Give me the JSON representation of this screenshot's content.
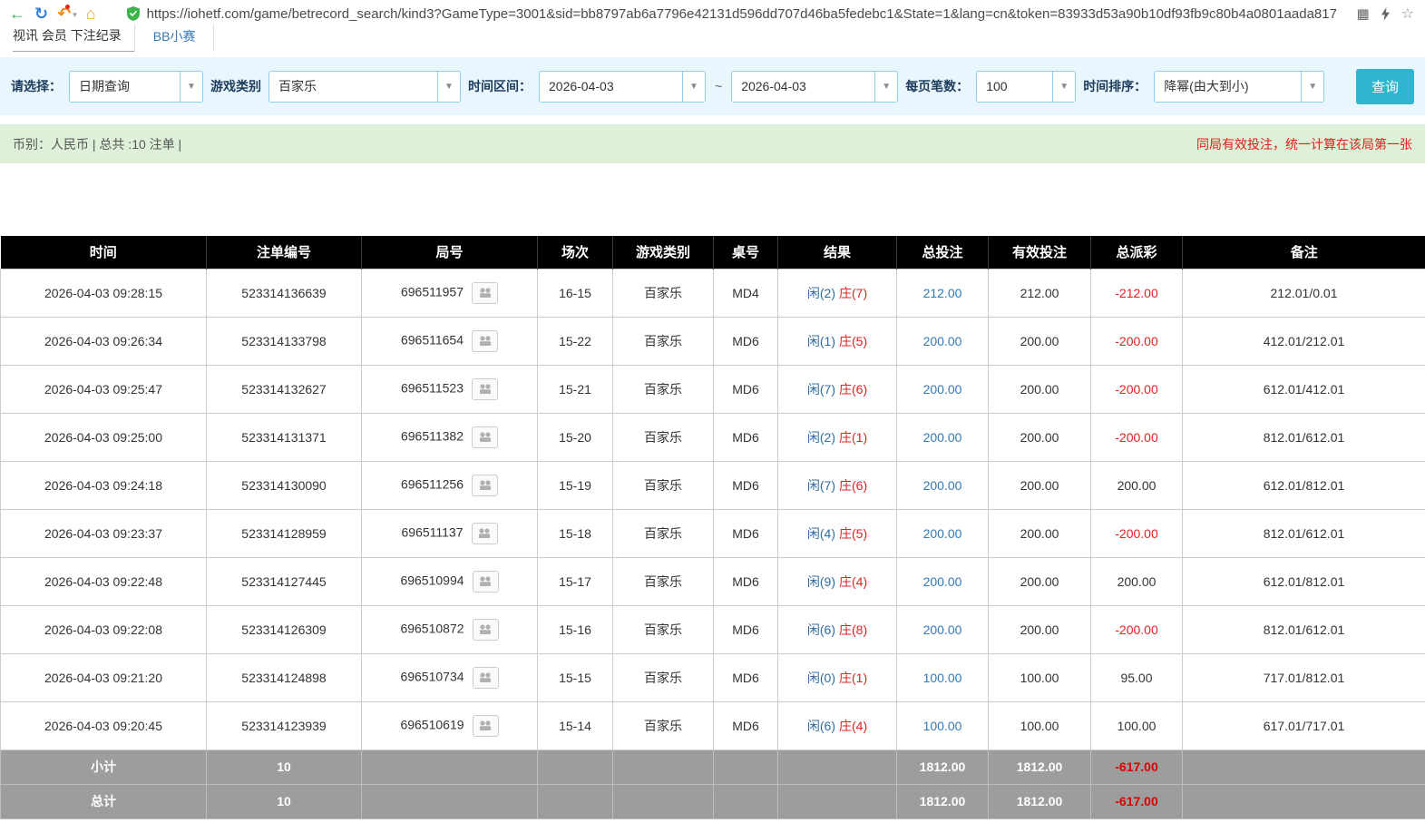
{
  "browser": {
    "url": "https://iohetf.com/game/betrecord_search/kind3?GameType=3001&sid=bb8797ab6a7796e42131d596dd707d46ba5fedebc1&State=1&lang=cn&token=83933d53a90b10df93fb9c80b4a0801aada817"
  },
  "icons": {
    "back": "←",
    "refresh": "↻",
    "undo": "↶",
    "caret_small": "▾",
    "home": "⌂",
    "grid": "▦",
    "star": "☆",
    "dropdown_caret": "▼"
  },
  "nav": {
    "breadcrumb": "视讯 会员 下注纪录",
    "tab": "BB小赛"
  },
  "filters": {
    "select_label": "请选择：",
    "select_value": "日期查询",
    "game_type_label": "游戏类别",
    "game_type_value": "百家乐",
    "date_range_label": "时间区间：",
    "date_from": "2026-04-03",
    "date_separator": "~",
    "date_to": "2026-04-03",
    "page_size_label": "每页笔数：",
    "page_size_value": "100",
    "sort_label": "时间排序：",
    "sort_value": "降幂(由大到小)",
    "search_button": "查询"
  },
  "summary": {
    "left": "币别：人民币 | 总共 :10 注单 |",
    "right": "同局有效投注，统一计算在该局第一张"
  },
  "table": {
    "headers": [
      "时间",
      "注单编号",
      "局号",
      "场次",
      "游戏类别",
      "桌号",
      "结果",
      "总投注",
      "有效投注",
      "总派彩",
      "备注"
    ],
    "rows": [
      {
        "time": "2026-04-03 09:28:15",
        "bet_id": "523314136639",
        "round_id": "696511957",
        "session": "16-15",
        "game": "百家乐",
        "table_no": "MD4",
        "result_player": "闲(2)",
        "result_banker": "庄(7)",
        "total_bet": "212.00",
        "valid_bet": "212.00",
        "payout": "-212.00",
        "remark": "212.01/0.01"
      },
      {
        "time": "2026-04-03 09:26:34",
        "bet_id": "523314133798",
        "round_id": "696511654",
        "session": "15-22",
        "game": "百家乐",
        "table_no": "MD6",
        "result_player": "闲(1)",
        "result_banker": "庄(5)",
        "total_bet": "200.00",
        "valid_bet": "200.00",
        "payout": "-200.00",
        "remark": "412.01/212.01"
      },
      {
        "time": "2026-04-03 09:25:47",
        "bet_id": "523314132627",
        "round_id": "696511523",
        "session": "15-21",
        "game": "百家乐",
        "table_no": "MD6",
        "result_player": "闲(7)",
        "result_banker": "庄(6)",
        "total_bet": "200.00",
        "valid_bet": "200.00",
        "payout": "-200.00",
        "remark": "612.01/412.01"
      },
      {
        "time": "2026-04-03 09:25:00",
        "bet_id": "523314131371",
        "round_id": "696511382",
        "session": "15-20",
        "game": "百家乐",
        "table_no": "MD6",
        "result_player": "闲(2)",
        "result_banker": "庄(1)",
        "total_bet": "200.00",
        "valid_bet": "200.00",
        "payout": "-200.00",
        "remark": "812.01/612.01"
      },
      {
        "time": "2026-04-03 09:24:18",
        "bet_id": "523314130090",
        "round_id": "696511256",
        "session": "15-19",
        "game": "百家乐",
        "table_no": "MD6",
        "result_player": "闲(7)",
        "result_banker": "庄(6)",
        "total_bet": "200.00",
        "valid_bet": "200.00",
        "payout": "200.00",
        "remark": "612.01/812.01"
      },
      {
        "time": "2026-04-03 09:23:37",
        "bet_id": "523314128959",
        "round_id": "696511137",
        "session": "15-18",
        "game": "百家乐",
        "table_no": "MD6",
        "result_player": "闲(4)",
        "result_banker": "庄(5)",
        "total_bet": "200.00",
        "valid_bet": "200.00",
        "payout": "-200.00",
        "remark": "812.01/612.01"
      },
      {
        "time": "2026-04-03 09:22:48",
        "bet_id": "523314127445",
        "round_id": "696510994",
        "session": "15-17",
        "game": "百家乐",
        "table_no": "MD6",
        "result_player": "闲(9)",
        "result_banker": "庄(4)",
        "total_bet": "200.00",
        "valid_bet": "200.00",
        "payout": "200.00",
        "remark": "612.01/812.01"
      },
      {
        "time": "2026-04-03 09:22:08",
        "bet_id": "523314126309",
        "round_id": "696510872",
        "session": "15-16",
        "game": "百家乐",
        "table_no": "MD6",
        "result_player": "闲(6)",
        "result_banker": "庄(8)",
        "total_bet": "200.00",
        "valid_bet": "200.00",
        "payout": "-200.00",
        "remark": "812.01/612.01"
      },
      {
        "time": "2026-04-03 09:21:20",
        "bet_id": "523314124898",
        "round_id": "696510734",
        "session": "15-15",
        "game": "百家乐",
        "table_no": "MD6",
        "result_player": "闲(0)",
        "result_banker": "庄(1)",
        "total_bet": "100.00",
        "valid_bet": "100.00",
        "payout": "95.00",
        "remark": "717.01/812.01"
      },
      {
        "time": "2026-04-03 09:20:45",
        "bet_id": "523314123939",
        "round_id": "696510619",
        "session": "15-14",
        "game": "百家乐",
        "table_no": "MD6",
        "result_player": "闲(6)",
        "result_banker": "庄(4)",
        "total_bet": "100.00",
        "valid_bet": "100.00",
        "payout": "100.00",
        "remark": "617.01/717.01"
      }
    ],
    "subtotal": {
      "label": "小计",
      "count": "10",
      "total_bet": "1812.00",
      "valid_bet": "1812.00",
      "payout": "-617.00"
    },
    "total": {
      "label": "总计",
      "count": "10",
      "total_bet": "1812.00",
      "valid_bet": "1812.00",
      "payout": "-617.00"
    }
  }
}
